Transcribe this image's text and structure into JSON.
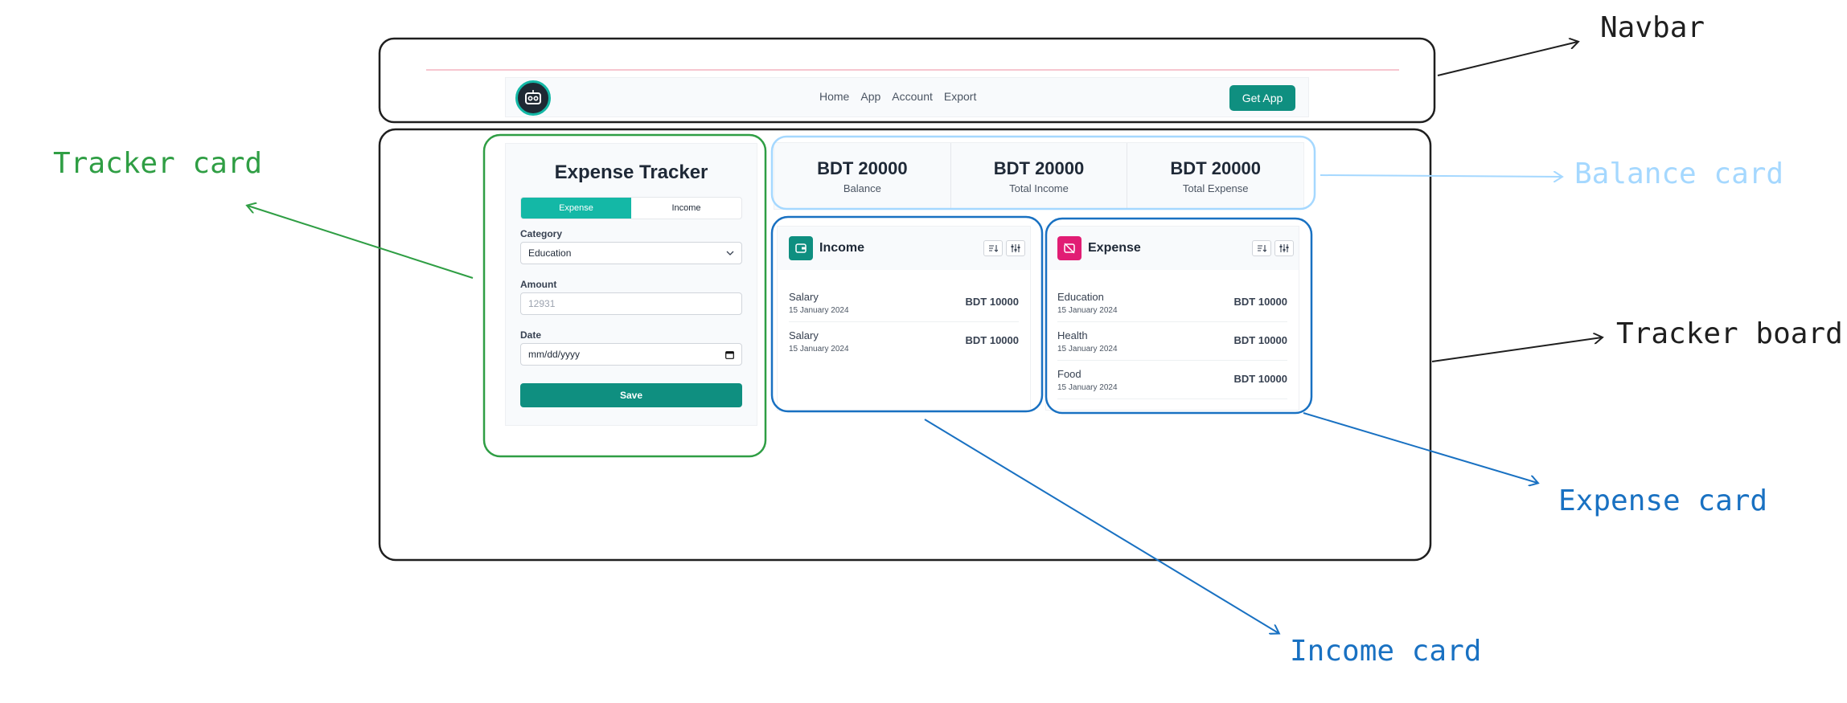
{
  "annotations": {
    "navbar": "Navbar",
    "tracker_card": "Tracker card",
    "balance_card": "Balance card",
    "tracker_board": "Tracker board",
    "expense_card": "Expense card",
    "income_card": "Income card"
  },
  "colors": {
    "annotation_black": "#1f1f1f",
    "annotation_green": "#2f9e44",
    "annotation_lightblue": "#a5d8ff",
    "annotation_blue": "#1971c2",
    "accent_teal": "#14b8a6",
    "button_teal": "#0f8f80",
    "expense_pink": "#e11d74"
  },
  "navbar": {
    "logo_icon": "robot-face-icon",
    "links": [
      "Home",
      "App",
      "Account",
      "Export"
    ],
    "cta": "Get App"
  },
  "tracker": {
    "title": "Expense Tracker",
    "tabs": {
      "expense": "Expense",
      "income": "Income"
    },
    "category_label": "Category",
    "category_value": "Education",
    "amount_label": "Amount",
    "amount_placeholder": "12931",
    "date_label": "Date",
    "date_placeholder": "mm/dd/yyyy",
    "save": "Save"
  },
  "balance": [
    {
      "value": "BDT 20000",
      "label": "Balance"
    },
    {
      "value": "BDT 20000",
      "label": "Total Income"
    },
    {
      "value": "BDT 20000",
      "label": "Total Expense"
    }
  ],
  "income": {
    "title": "Income",
    "rows": [
      {
        "title": "Salary",
        "date": "15 January 2024",
        "amount": "BDT 10000"
      },
      {
        "title": "Salary",
        "date": "15 January 2024",
        "amount": "BDT 10000"
      }
    ]
  },
  "expense": {
    "title": "Expense",
    "rows": [
      {
        "title": "Education",
        "date": "15 January 2024",
        "amount": "BDT 10000"
      },
      {
        "title": "Health",
        "date": "15 January 2024",
        "amount": "BDT 10000"
      },
      {
        "title": "Food",
        "date": "15 January 2024",
        "amount": "BDT 10000"
      }
    ]
  }
}
